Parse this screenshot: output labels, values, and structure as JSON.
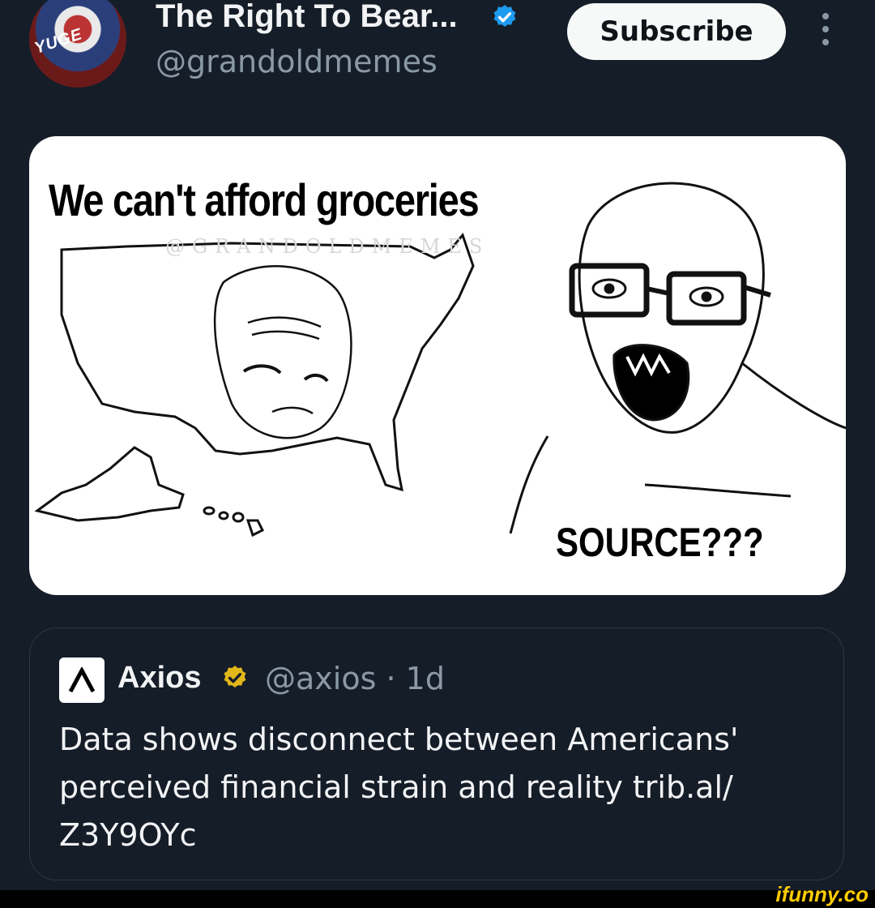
{
  "header": {
    "author_name": "The Right To Bear...",
    "author_handle": "@grandoldmemes",
    "subscribe_label": "Subscribe",
    "avatar_text": "YUGE"
  },
  "meme": {
    "top_text": "We can't afford groceries",
    "bottom_text": "SOURCE???",
    "watermark": "@GRANDOLDMEMES"
  },
  "quote_tweet": {
    "author_name": "Axios",
    "author_handle": "@axios",
    "time": "· 1d",
    "text": "Data shows disconnect between Americans' perceived financial strain and reality trib.al/ Z3Y9OYc"
  },
  "footer": {
    "watermark": "ifunny.co"
  },
  "colors": {
    "background": "#151d28",
    "verified_blue": "#1d9bf0",
    "verified_gold": "#e2b719",
    "ifunny_yellow": "#ffcc00"
  }
}
